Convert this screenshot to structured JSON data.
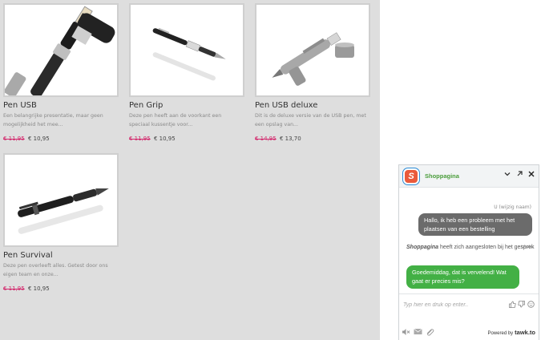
{
  "products": [
    {
      "name": "Pen USB",
      "description": "Een belangrijke presentatie, maar geen mogelijkheid het mee...",
      "old_price": "€ 11,95",
      "new_price": "€ 10,95",
      "image": "usb-pen-drive"
    },
    {
      "name": "Pen Grip",
      "description": "Deze pen heeft aan de voorkant een speciaal kussentje voor...",
      "old_price": "€ 11,95",
      "new_price": "€ 10,95",
      "image": "grip-pen"
    },
    {
      "name": "Pen USB deluxe",
      "description": "Dit is de deluxe versie van de USB pen, met een opslag van...",
      "old_price": "€ 14,95",
      "new_price": "€ 13,70",
      "image": "silver-usb-pen"
    },
    {
      "name": "Pen Survival",
      "description": "Deze pen overleeft alles. Getest door ons eigen team en onze...",
      "old_price": "€ 11,95",
      "new_price": "€ 10,95",
      "image": "black-survival-pen"
    }
  ],
  "chat": {
    "logo_letter": "S",
    "title": "Shoppagina",
    "visitor_label": "U (wijzig naam)",
    "visitor_message": "Hallo, ik heb een probleem met het plaatsen van een bestelling",
    "system_agent": "Shoppagina",
    "system_text": "heeft zich aangesloten bij het gesprek",
    "system_time": "16:44",
    "agent_message": "Goedemiddag, dat is vervelend! Wat gaat er precies mis?",
    "input_placeholder": "Typ hier en druk op enter..",
    "powered_label": "Powered by",
    "powered_brand": "tawk.to",
    "colors": {
      "title": "#4a9d3b",
      "agent_bubble": "#43b045",
      "visitor_bubble": "#6b6b6b",
      "logo": "#ea5a3b"
    }
  }
}
